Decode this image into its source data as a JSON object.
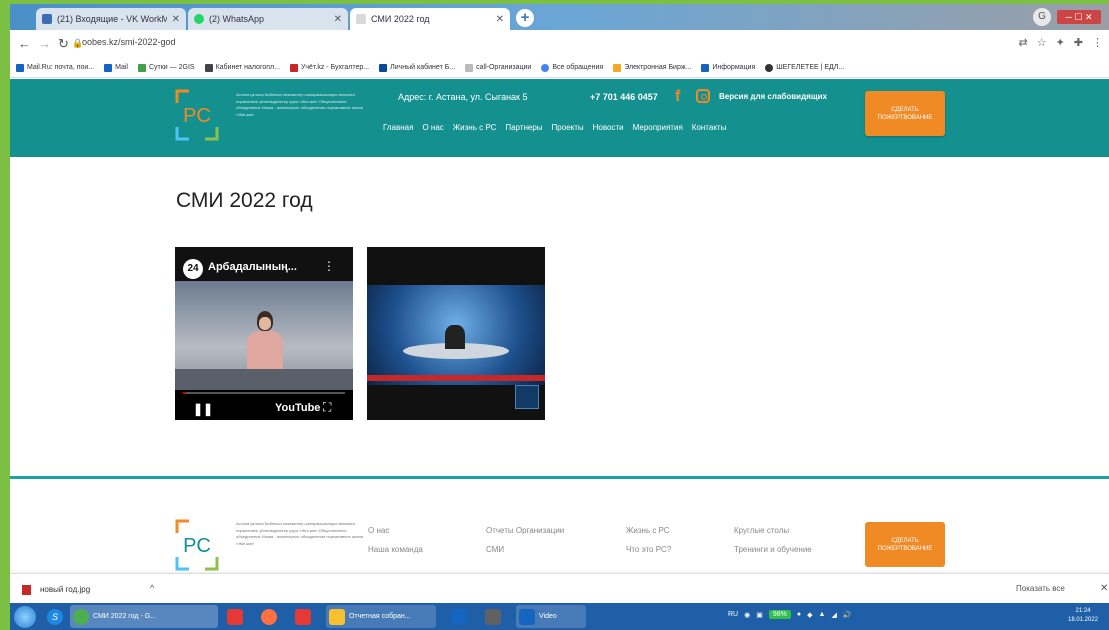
{
  "browser": {
    "tabs": [
      {
        "title": "(21) Входящие - VK WorkMail",
        "color": "#3b6db3",
        "active": false
      },
      {
        "title": "(2) WhatsApp",
        "color": "#25d366",
        "active": false
      },
      {
        "title": "СМИ 2022 год",
        "color": "#d9d9d9",
        "active": true
      }
    ],
    "new_tab": "+",
    "profile": "G",
    "url": "oobes.kz/smi-2022-god",
    "bookmarks": [
      "Mail.Ru: почта, пои...",
      "Mail",
      "Сутки — 2GIS",
      "Кабинет налогопл...",
      "Учёт.kz - Бухгалтер...",
      "Личный кабинет Б...",
      "call-Организации",
      "Все обращения",
      "Электронная Бирж...",
      "Информация",
      "ШЕГЕЛЕТЕЕ | ЕДЛ..."
    ]
  },
  "site": {
    "logo": "PC",
    "logo_text": "Астана қаласы Бейнеши мекемелер шығармашылары мекемесі нормативтік үйлесімділіктер қоры «Жиі жиі» Общественное объединение Иньва - инженерное объединения нормативное жизни «Жиі жиі»",
    "address": "Адрес: г. Астана, ул. Сыганак 5",
    "phone": "+7 701 446 0457",
    "accessible": "Версия для слабовидящих",
    "nav": [
      "Главная",
      "О нас",
      "Жизнь с РС",
      "Партнеры",
      "Проекты",
      "Новости",
      "Мероприятия",
      "Контакты"
    ],
    "donate": "СДЕЛАТЬ ПОЖЕРТВОВАНИЕ",
    "page_title": "СМИ 2022 год",
    "video1": {
      "channel": "24",
      "title": "Арбадалының...",
      "menu": "⋮",
      "pause": "❚❚",
      "youtube": "YouTube",
      "fullscreen": "⛶",
      "progress": 0.02
    },
    "footer": {
      "col1": [
        "О нас",
        "Наша команда"
      ],
      "col2": [
        "Отчеты Организации",
        "СМИ"
      ],
      "col3": [
        "Жизнь с РС",
        "Что это РС?"
      ],
      "col4": [
        "Круглые столы",
        "Тренинги и обучение"
      ],
      "donate": "СДЕЛАТЬ ПОЖЕРТВОВАНИЕ"
    }
  },
  "download_bar": {
    "file": "новый год.jpg",
    "caret": "^",
    "show_all": "Показать все",
    "close": "✕"
  },
  "taskbar": {
    "items": [
      {
        "label": "S",
        "color": "#1e88e5"
      },
      {
        "label": "СМИ 2022 год - G...",
        "color": "#4caf50"
      },
      {
        "label": "",
        "color": "#e53935"
      },
      {
        "label": "",
        "color": "#ff7043"
      },
      {
        "label": "",
        "color": "#e53935"
      },
      {
        "label": "Отчетная собран...",
        "color": "#fbc02d"
      },
      {
        "label": "",
        "color": "#1565c0"
      },
      {
        "label": "",
        "color": "#616161"
      },
      {
        "label": "Video",
        "color": "#1565c0"
      }
    ],
    "lang": "RU",
    "battery": "98%",
    "time": "21:24",
    "date": "18.01.2022"
  }
}
